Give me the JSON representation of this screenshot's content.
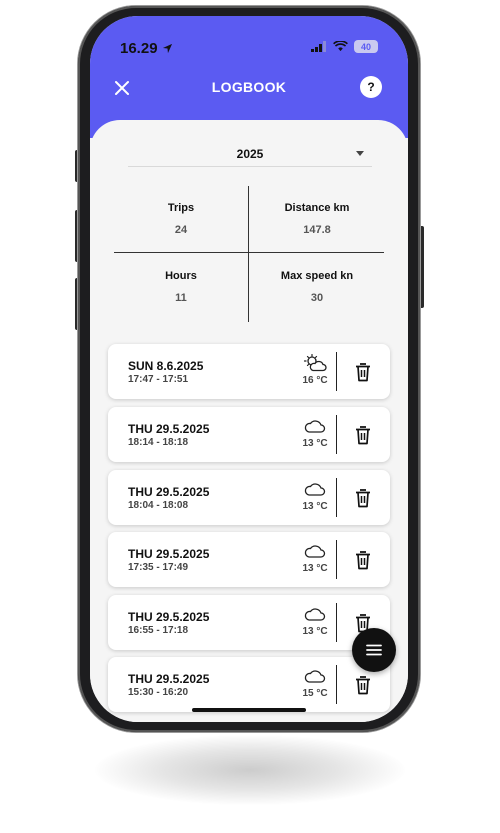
{
  "status_bar": {
    "time": "16.29",
    "battery": "40"
  },
  "header": {
    "title": "LOGBOOK",
    "close_icon": "close-icon",
    "help_label": "?"
  },
  "filter": {
    "year": "2025"
  },
  "stats": {
    "trips": {
      "label": "Trips",
      "value": "24"
    },
    "distance": {
      "label": "Distance km",
      "value": "147.8"
    },
    "hours": {
      "label": "Hours",
      "value": "11"
    },
    "max_speed": {
      "label": "Max speed kn",
      "value": "30"
    }
  },
  "trips": [
    {
      "date": "SUN 8.6.2025",
      "time": "17:47 - 17:51",
      "weather_icon": "partly-cloudy-icon",
      "temp": "16 °C"
    },
    {
      "date": "THU 29.5.2025",
      "time": "18:14 - 18:18",
      "weather_icon": "cloud-icon",
      "temp": "13 °C"
    },
    {
      "date": "THU 29.5.2025",
      "time": "18:04 - 18:08",
      "weather_icon": "cloud-icon",
      "temp": "13 °C"
    },
    {
      "date": "THU 29.5.2025",
      "time": "17:35 - 17:49",
      "weather_icon": "cloud-icon",
      "temp": "13 °C"
    },
    {
      "date": "THU 29.5.2025",
      "time": "16:55 - 17:18",
      "weather_icon": "cloud-icon",
      "temp": "13 °C"
    },
    {
      "date": "THU 29.5.2025",
      "time": "15:30 - 16:20",
      "weather_icon": "cloud-icon",
      "temp": "15 °C"
    }
  ],
  "colors": {
    "accent": "#5b5bf2",
    "background": "#f5f5f5",
    "fab": "#111111"
  }
}
